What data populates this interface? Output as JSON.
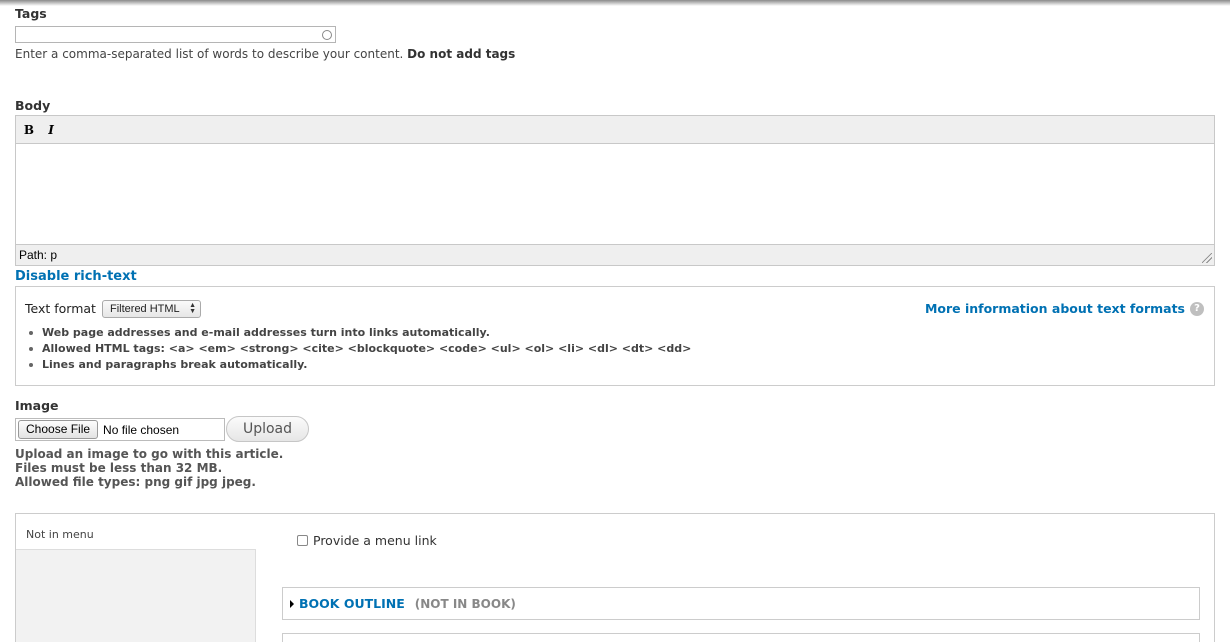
{
  "tags": {
    "label": "Tags",
    "value": "",
    "description": "Enter a comma-separated list of words to describe your content.",
    "description_strong": "Do not add tags"
  },
  "body": {
    "label": "Body",
    "toolbar": {
      "bold": "B",
      "italic": "I"
    },
    "path": "Path: p",
    "disable_rich_text": "Disable rich-text"
  },
  "text_format": {
    "label": "Text format",
    "selected": "Filtered HTML",
    "more_info": "More information about text formats",
    "help_icon": "question-icon",
    "tips": [
      "Web page addresses and e-mail addresses turn into links automatically.",
      "Allowed HTML tags: <a> <em> <strong> <cite> <blockquote> <code> <ul> <ol> <li> <dl> <dt> <dd>",
      "Lines and paragraphs break automatically."
    ]
  },
  "image": {
    "label": "Image",
    "choose_file": "Choose File",
    "no_file": "No file chosen",
    "upload": "Upload",
    "desc_lines": [
      "Upload an image to go with this article.",
      "Files must be less than 32 MB.",
      "Allowed file types: png gif jpg jpeg."
    ]
  },
  "menu_settings": {
    "summary": "Not in menu",
    "checkbox_label": "Provide a menu link",
    "checked": false
  },
  "book_outline": {
    "title": "BOOK OUTLINE",
    "summary": "(NOT IN BOOK)"
  },
  "colors": {
    "link": "#0071b3",
    "text": "#3b3b3b",
    "border": "#cccccc"
  }
}
